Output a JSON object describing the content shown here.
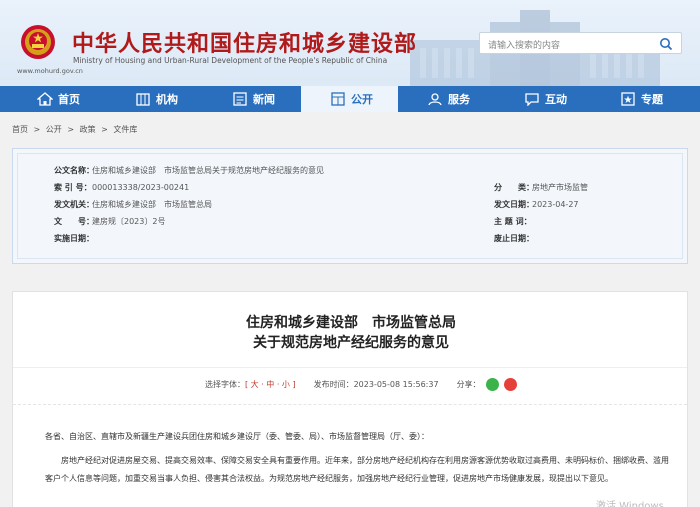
{
  "header": {
    "title": "中华人民共和国住房和城乡建设部",
    "subtitle": "Ministry of Housing and Urban-Rural Development of the People's Republic of China",
    "domain": "www.mohurd.gov.cn",
    "search_placeholder": "请输入搜索的内容"
  },
  "nav": [
    {
      "label": "首页",
      "icon": "home-icon"
    },
    {
      "label": "机构",
      "icon": "building-icon"
    },
    {
      "label": "新闻",
      "icon": "news-icon"
    },
    {
      "label": "公开",
      "icon": "public-icon",
      "active": true
    },
    {
      "label": "服务",
      "icon": "service-icon"
    },
    {
      "label": "互动",
      "icon": "chat-icon"
    },
    {
      "label": "专题",
      "icon": "topic-icon"
    }
  ],
  "breadcrumb": [
    "首页",
    ">",
    "公开",
    ">",
    "政策",
    ">",
    "文件库"
  ],
  "meta": {
    "publisher_label": "公文名称：",
    "publisher": "住房和城乡建设部　市场监管总局关于规范房地产经纪服务的意见",
    "index_label": "索 引 号：",
    "index": "000013338/2023-00241",
    "issuer_label": "发文机关：",
    "issuer": "住房和城乡建设部　市场监管总局",
    "docno_label": "文　　号：",
    "docno": "建房规〔2023〕2号",
    "effective_label": "实施日期：",
    "effective": "",
    "category_label": "分　　类：",
    "category": "房地产市场监管",
    "date_label": "发文日期：",
    "date": "2023-04-27",
    "topic_label": "主 题 词：",
    "topic": "",
    "abolish_label": "废止日期：",
    "abolish": ""
  },
  "doc": {
    "title_line1": "住房和城乡建设部　市场监管总局",
    "title_line2": "关于规范房地产经纪服务的意见",
    "font_label": "选择字体：",
    "font_sizes": "[ 大 · 中 · 小 ]",
    "pub_label": "发布时间：",
    "pub_time": "2023-05-08 15:56:37",
    "share_label": "分享：",
    "addressee": "各省、自治区、直辖市及新疆生产建设兵团住房和城乡建设厅（委、管委、局）、市场监督管理局（厅、委）：",
    "para1": "房地产经纪对促进房屋交易、提高交易效率、保障交易安全具有重要作用。近年来，部分房地产经纪机构存在利用房源客源优势收取过高费用、未明码标价、捆绑收费、滥用客户个人信息等问题，加重交易当事人负担、侵害其合法权益。为规范房地产经纪服务，加强房地产经纪行业管理，促进房地产市场健康发展，现提出以下意见。"
  },
  "watermark": "激活 Windows",
  "colors": {
    "brand_red": "#b01a1a",
    "nav_blue": "#2a6fbe"
  }
}
